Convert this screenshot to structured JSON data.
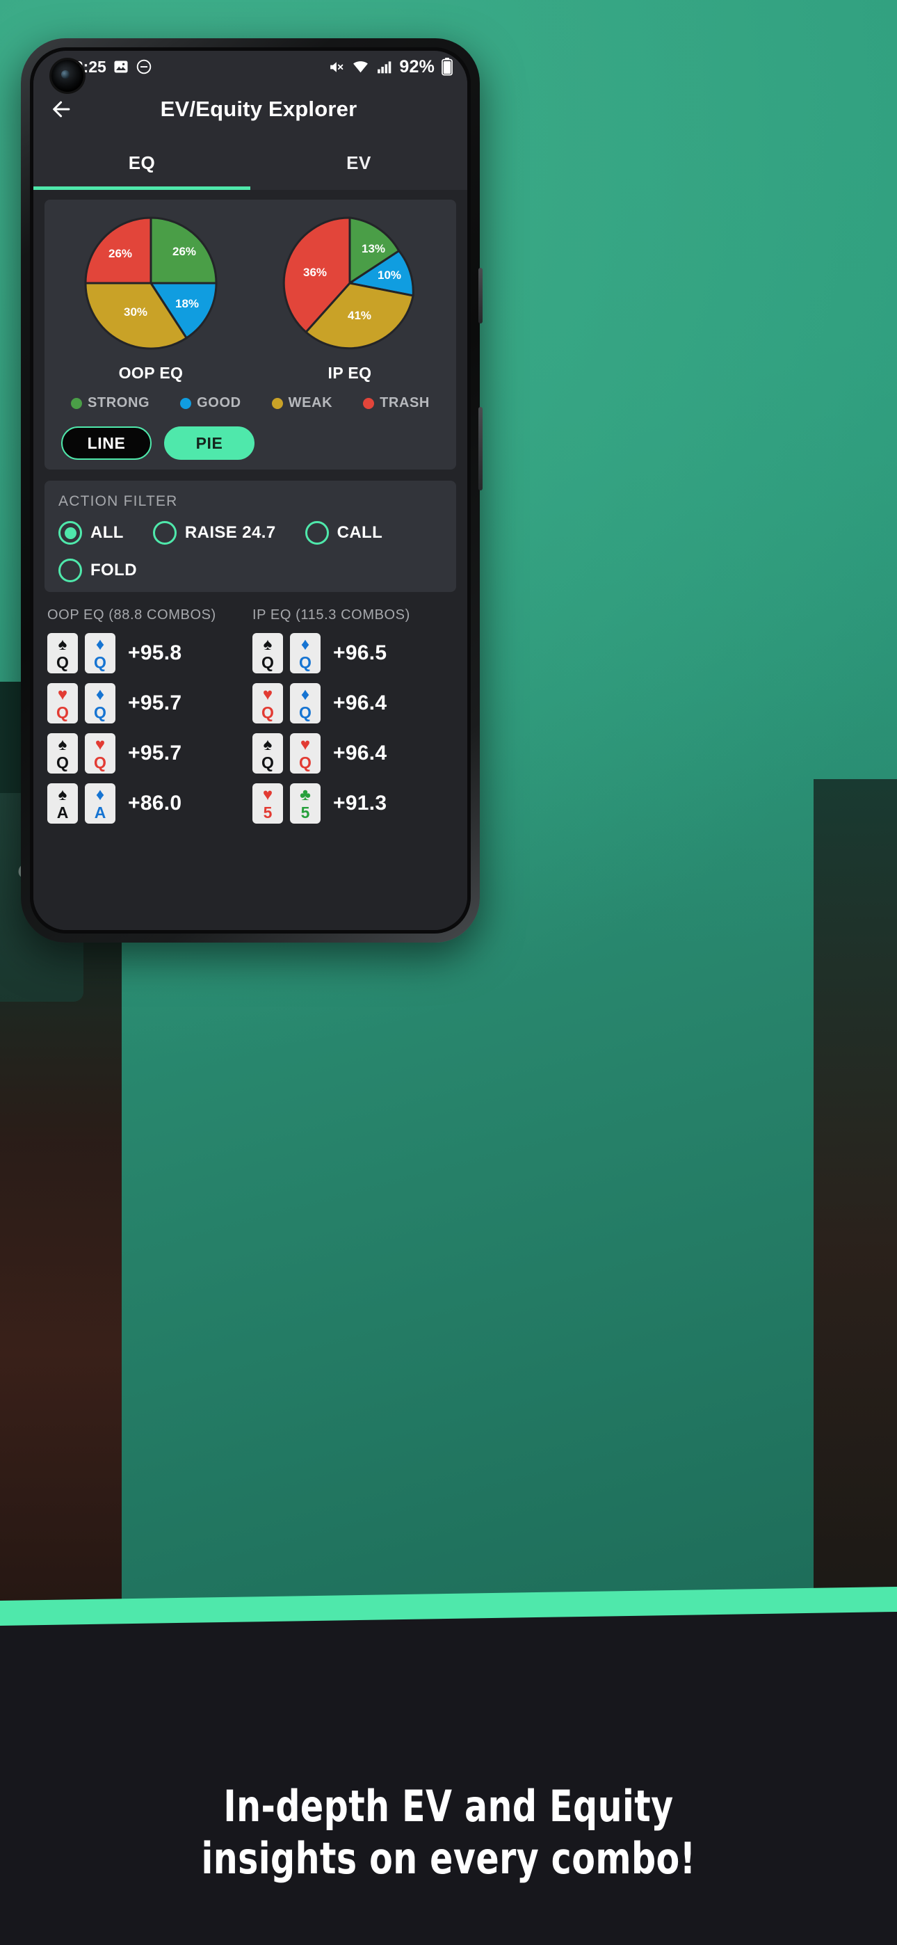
{
  "status_bar": {
    "time": "12:25",
    "left_icons": [
      "image-icon",
      "do-not-disturb-icon"
    ],
    "right_icons": [
      "mute-icon",
      "wifi-icon",
      "signal-icon"
    ],
    "battery": "92%"
  },
  "appbar": {
    "back_icon": "back-arrow-icon",
    "title": "EV/Equity Explorer"
  },
  "tabs": [
    {
      "label": "EQ",
      "active": true
    },
    {
      "label": "EV",
      "active": false
    }
  ],
  "chart_data": [
    {
      "type": "pie",
      "title": "OOP EQ",
      "categories": [
        "TRASH",
        "STRONG",
        "GOOD",
        "WEAK"
      ],
      "values": [
        26,
        26,
        18,
        30
      ],
      "labels": [
        "26%",
        "26%",
        "18%",
        "30%"
      ],
      "colors": [
        "#e2453a",
        "#4a9e47",
        "#109de0",
        "#c9a227"
      ],
      "legend_position": "below"
    },
    {
      "type": "pie",
      "title": "IP EQ",
      "categories": [
        "TRASH",
        "STRONG",
        "GOOD",
        "WEAK"
      ],
      "values": [
        36,
        13,
        10,
        41
      ],
      "labels": [
        "36%",
        "13%",
        "10%",
        "41%"
      ],
      "colors": [
        "#e2453a",
        "#4a9e47",
        "#109de0",
        "#c9a227"
      ],
      "legend_position": "below"
    }
  ],
  "legend": [
    {
      "label": "STRONG",
      "color": "#4a9e47"
    },
    {
      "label": "GOOD",
      "color": "#109de0"
    },
    {
      "label": "WEAK",
      "color": "#c9a227"
    },
    {
      "label": "TRASH",
      "color": "#e2453a"
    }
  ],
  "chart_toggles": [
    {
      "label": "LINE",
      "selected": false
    },
    {
      "label": "PIE",
      "selected": true
    }
  ],
  "action_filter": {
    "title": "ACTION FILTER",
    "options": [
      {
        "label": "ALL",
        "selected": true
      },
      {
        "label": "RAISE 24.7",
        "selected": false
      },
      {
        "label": "CALL",
        "selected": false
      },
      {
        "label": "FOLD",
        "selected": false
      }
    ]
  },
  "combo_lists": [
    {
      "header": "OOP EQ (88.8 COMBOS)",
      "rows": [
        {
          "cards": [
            {
              "rank": "Q",
              "suit": "♠",
              "color": "black"
            },
            {
              "rank": "Q",
              "suit": "♦",
              "color": "blue"
            }
          ],
          "value": "+95.8"
        },
        {
          "cards": [
            {
              "rank": "Q",
              "suit": "♥",
              "color": "red"
            },
            {
              "rank": "Q",
              "suit": "♦",
              "color": "blue"
            }
          ],
          "value": "+95.7"
        },
        {
          "cards": [
            {
              "rank": "Q",
              "suit": "♠",
              "color": "black"
            },
            {
              "rank": "Q",
              "suit": "♥",
              "color": "red"
            }
          ],
          "value": "+95.7"
        },
        {
          "cards": [
            {
              "rank": "A",
              "suit": "♠",
              "color": "black"
            },
            {
              "rank": "A",
              "suit": "♦",
              "color": "blue"
            }
          ],
          "value": "+86.0"
        }
      ]
    },
    {
      "header": "IP EQ (115.3 COMBOS)",
      "rows": [
        {
          "cards": [
            {
              "rank": "Q",
              "suit": "♠",
              "color": "black"
            },
            {
              "rank": "Q",
              "suit": "♦",
              "color": "blue"
            }
          ],
          "value": "+96.5"
        },
        {
          "cards": [
            {
              "rank": "Q",
              "suit": "♥",
              "color": "red"
            },
            {
              "rank": "Q",
              "suit": "♦",
              "color": "blue"
            }
          ],
          "value": "+96.4"
        },
        {
          "cards": [
            {
              "rank": "Q",
              "suit": "♠",
              "color": "black"
            },
            {
              "rank": "Q",
              "suit": "♥",
              "color": "red"
            }
          ],
          "value": "+96.4"
        },
        {
          "cards": [
            {
              "rank": "5",
              "suit": "♥",
              "color": "red"
            },
            {
              "rank": "5",
              "suit": "♣",
              "color": "green"
            }
          ],
          "value": "+91.3"
        }
      ]
    }
  ],
  "banner": {
    "line1": "In-depth EV and Equity",
    "line2": "insights on every combo!"
  },
  "theme": {
    "accent": "#4fe8ab",
    "background_green": "#2e9e7d",
    "screen_bg": "#232428",
    "card_bg": "#32343a",
    "appbar_bg": "#2b2c31"
  }
}
